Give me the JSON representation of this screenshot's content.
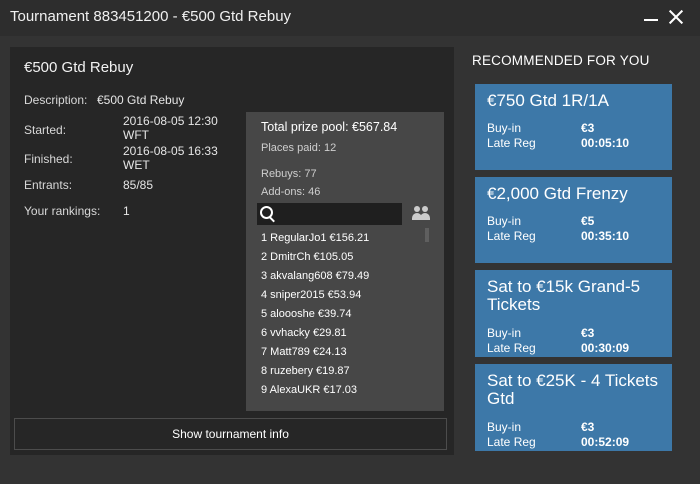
{
  "window": {
    "title": "Tournament 883451200 - €500 Gtd Rebuy"
  },
  "tournament": {
    "name": "€500 Gtd Rebuy",
    "description_label": "Description:",
    "description_value": "€500 Gtd Rebuy",
    "started_label": "Started:",
    "started_value": "2016-08-05 12:30 WFT",
    "finished_label": "Finished:",
    "finished_value": "2016-08-05 16:33 WET",
    "entrants_label": "Entrants:",
    "entrants_value": "85/85",
    "rankings_label": "Your rankings:",
    "rankings_value": "1"
  },
  "prize": {
    "total": "Total prize pool: €567.84",
    "places_paid": "Places paid: 12",
    "rebuys": "Rebuys: 77",
    "addons": "Add-ons: 46",
    "search_placeholder": ""
  },
  "rankings": [
    "1 RegularJo1 €156.21",
    "2 DmitrCh €105.05",
    "3 akvalang608 €79.49",
    "4 sniper2015 €53.94",
    "5 aloooshe €39.74",
    "6 vvhacky €29.81",
    "7 Matt789 €24.13",
    "8 ruzebery €19.87",
    "9 AlexaUKR €17.03"
  ],
  "show_info_button": "Show tournament info",
  "recommended": {
    "header": "RECOMMENDED FOR YOU",
    "buyin_label": "Buy-in",
    "latereg_label": "Late Reg",
    "cards": [
      {
        "title": "€750 Gtd 1R/1A",
        "buyin": "€3",
        "late_reg": "00:05:10"
      },
      {
        "title": "€2,000 Gtd Frenzy",
        "buyin": "€5",
        "late_reg": "00:35:10"
      },
      {
        "title": "Sat to €15k Grand-5 Tickets",
        "buyin": "€3",
        "late_reg": "00:30:09"
      },
      {
        "title": "Sat to €25K - 4 Tickets Gtd",
        "buyin": "€3",
        "late_reg": "00:52:09"
      }
    ]
  },
  "colors": {
    "card_blue": "#3d78a8",
    "panel_dark": "#262626",
    "background": "#333333"
  }
}
